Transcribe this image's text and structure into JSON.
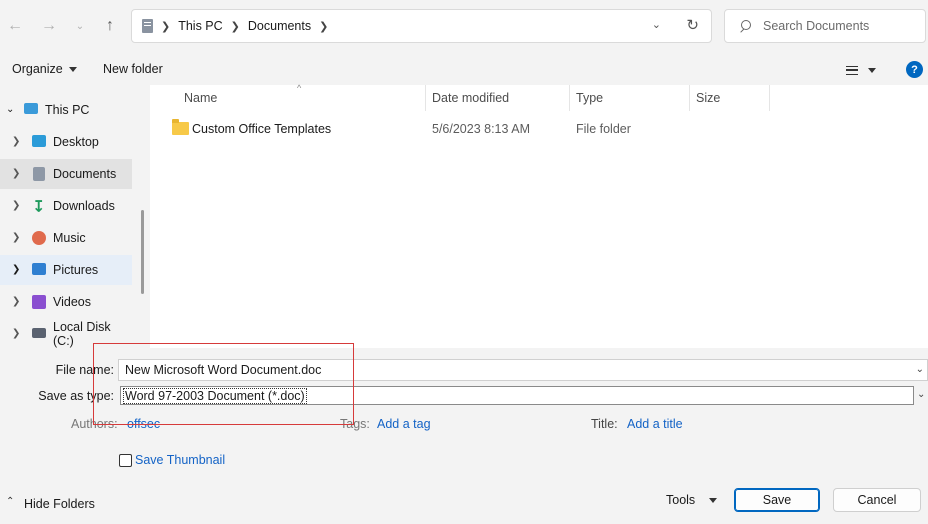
{
  "nav": {
    "back_icon": "arrow-left-icon",
    "forward_icon": "arrow-right-icon",
    "recent_icon": "chevron-down-icon",
    "up_icon": "arrow-up-icon"
  },
  "address": {
    "crumbs": [
      "This PC",
      "Documents"
    ]
  },
  "search": {
    "placeholder": "Search Documents"
  },
  "command_bar": {
    "organize": "Organize",
    "new_folder": "New folder",
    "help": "?"
  },
  "sidebar": {
    "items": [
      {
        "label": "This PC",
        "icon": "monitor-icon"
      },
      {
        "label": "Desktop",
        "icon": "desktop-icon"
      },
      {
        "label": "Documents",
        "icon": "documents-icon"
      },
      {
        "label": "Downloads",
        "icon": "download-icon"
      },
      {
        "label": "Music",
        "icon": "music-icon"
      },
      {
        "label": "Pictures",
        "icon": "pictures-icon"
      },
      {
        "label": "Videos",
        "icon": "videos-icon"
      },
      {
        "label": "Local Disk (C:)",
        "icon": "drive-icon"
      }
    ]
  },
  "columns": {
    "name": "Name",
    "date": "Date modified",
    "type": "Type",
    "size": "Size"
  },
  "files": [
    {
      "name": "Custom Office Templates",
      "date": "5/6/2023 8:13 AM",
      "type": "File folder",
      "size": ""
    }
  ],
  "form": {
    "file_name_label": "File name:",
    "file_name_value": "New Microsoft Word Document.doc",
    "save_type_label": "Save as type:",
    "save_type_value": "Word 97-2003 Document (*.doc)",
    "authors_label": "Authors:",
    "authors_value": "offsec",
    "tags_label": "Tags:",
    "tags_value": "Add a tag",
    "title_label": "Title:",
    "title_value": "Add a title",
    "thumbnail_label": "Save Thumbnail"
  },
  "footer": {
    "hide_folders": "Hide Folders",
    "tools": "Tools",
    "save": "Save",
    "cancel": "Cancel"
  },
  "colors": {
    "accent": "#0067c0",
    "highlight": "#d63a3a",
    "folder": "#f7c948"
  }
}
